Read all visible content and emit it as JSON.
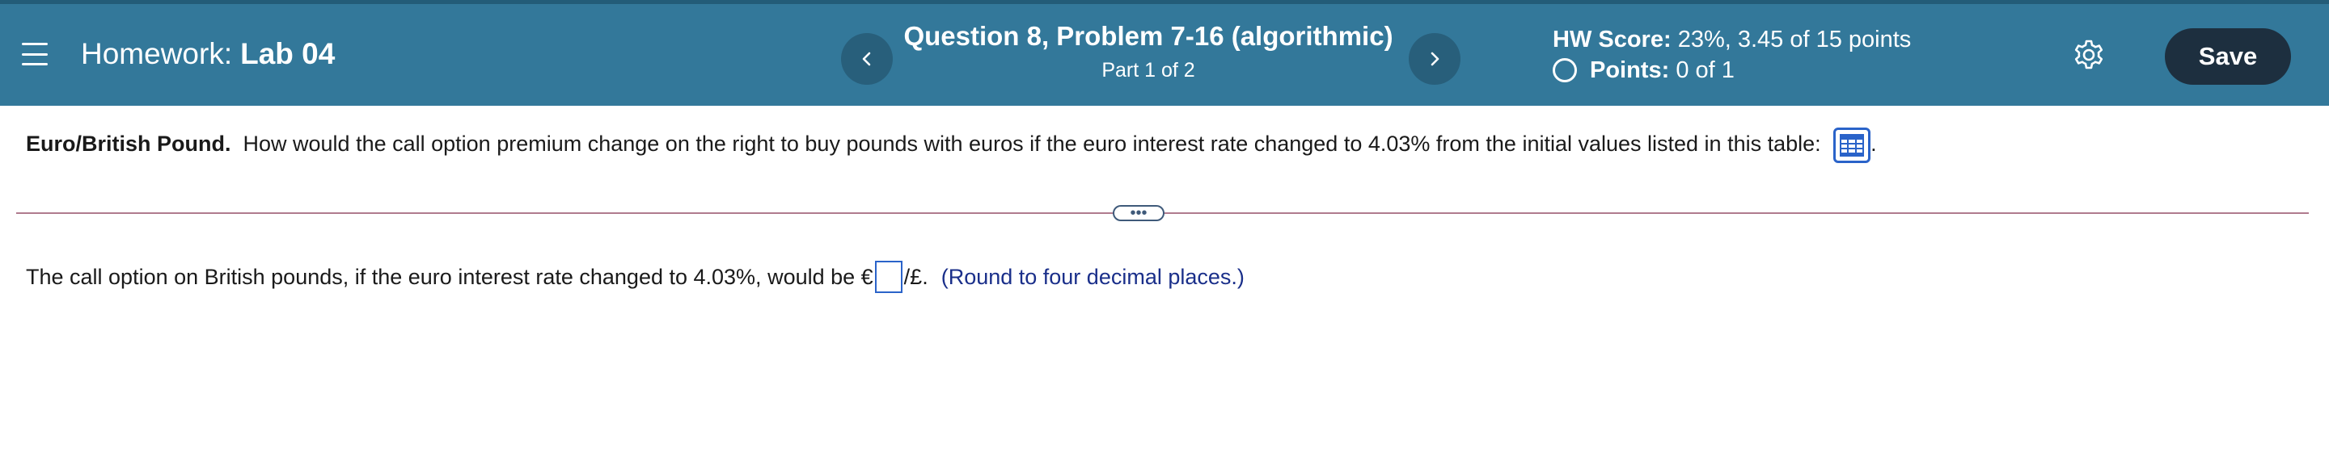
{
  "header": {
    "homework_label": "Homework:",
    "homework_name": "Lab 04",
    "question_title": "Question 8, Problem 7-16 (algorithmic)",
    "question_part": "Part 1 of 2",
    "hw_score_label": "HW Score:",
    "hw_score_value": "23%, 3.45 of 15 points",
    "points_label": "Points:",
    "points_value": "0 of 1",
    "save_label": "Save",
    "colors": {
      "bar": "#33789a",
      "nav_button": "#285f7b",
      "save_button": "#1d2f3f"
    }
  },
  "question": {
    "bold_lead": "Euro/British Pound.",
    "body": "How would the call option premium change on the right to buy pounds with euros if the euro interest rate changed to 4.03% from the initial values listed in this table:",
    "trailing": "."
  },
  "answer": {
    "prefix": "The call option on British pounds, if the euro interest rate changed to 4.03%, would be €",
    "suffix": "/£.",
    "hint": "(Round to four decimal places.)",
    "input_value": ""
  },
  "icons": {
    "menu": "hamburger-icon",
    "prev": "chevron-left-icon",
    "next": "chevron-right-icon",
    "settings": "gear-icon",
    "table": "table-icon",
    "more": "ellipsis-icon"
  }
}
